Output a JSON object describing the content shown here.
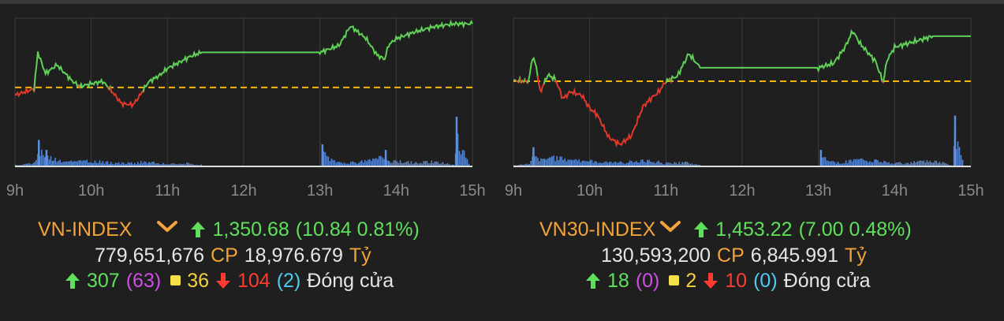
{
  "colors": {
    "background": "#1f1f1f",
    "grid": "#3c3c3c",
    "axis": "#dddddd",
    "up_line": "#5fd157",
    "down_line": "#e0392b",
    "reference": "#f5b800",
    "volume": "#5b8fe0",
    "label_orange": "#f2a33a",
    "up_green": "#5fe05a",
    "down_red": "#ff3b30"
  },
  "icons": {
    "up": "arrow-up-icon",
    "down": "arrow-down-icon",
    "chevron": "chevron-down-icon",
    "unchanged": "yellow-square-icon"
  },
  "chart_data": [
    {
      "type": "line",
      "x_ticks": [
        "9h",
        "10h",
        "11h",
        "12h",
        "13h",
        "14h",
        "15h"
      ],
      "x_range": [
        9,
        15
      ],
      "reference": 1339.84,
      "y_range": [
        1326,
        1352
      ],
      "price_series": {
        "x": [
          9.0,
          9.25,
          9.3,
          9.4,
          9.55,
          9.75,
          9.85,
          10.0,
          10.15,
          10.25,
          10.4,
          10.55,
          10.65,
          10.75,
          10.9,
          11.0,
          11.15,
          11.3,
          11.45,
          12.0,
          13.0,
          13.25,
          13.4,
          13.6,
          13.75,
          13.85,
          13.9,
          14.0,
          14.25,
          14.5,
          14.75,
          15.0
        ],
        "y": [
          1338.5,
          1339.6,
          1346.0,
          1342.3,
          1343.8,
          1341.0,
          1340.0,
          1340.5,
          1340.9,
          1339.5,
          1337.0,
          1336.8,
          1338.7,
          1340.8,
          1342.0,
          1343.2,
          1344.2,
          1345.3,
          1346.0,
          1346.0,
          1346.0,
          1347.2,
          1350.6,
          1348.5,
          1345.5,
          1344.8,
          1347.3,
          1348.4,
          1349.6,
          1350.5,
          1351.0,
          1351.0
        ]
      },
      "volume_series": {
        "x": [
          9.0,
          9.1,
          9.15,
          9.25,
          9.3,
          9.4,
          9.5,
          9.75,
          10.0,
          10.25,
          10.5,
          10.75,
          11.0,
          11.25,
          11.45,
          13.0,
          13.02,
          13.25,
          13.5,
          13.85,
          13.9,
          14.25,
          14.5,
          14.75,
          14.78,
          14.95
        ],
        "v": [
          4,
          6,
          8,
          11,
          48,
          30,
          22,
          15,
          17,
          12,
          10,
          16,
          8,
          9,
          6,
          0,
          40,
          11,
          13,
          30,
          18,
          12,
          16,
          4,
          90,
          6
        ]
      },
      "volume_max": 100
    },
    {
      "type": "line",
      "x_ticks": [
        "9h",
        "10h",
        "11h",
        "12h",
        "13h",
        "14h",
        "15h"
      ],
      "x_range": [
        9,
        15
      ],
      "reference": 1446.22,
      "y_range": [
        1433,
        1456
      ],
      "price_series": {
        "x": [
          9.0,
          9.2,
          9.25,
          9.3,
          9.35,
          9.45,
          9.55,
          9.65,
          9.75,
          9.9,
          10.0,
          10.1,
          10.25,
          10.4,
          10.55,
          10.7,
          10.8,
          10.9,
          11.0,
          11.15,
          11.3,
          11.45,
          12.0,
          12.5,
          13.0,
          13.2,
          13.35,
          13.45,
          13.55,
          13.75,
          13.85,
          13.9,
          14.0,
          14.3,
          14.5,
          15.0
        ],
        "y": [
          1446.3,
          1446.2,
          1450.0,
          1448.5,
          1444.5,
          1447.2,
          1446.5,
          1443.5,
          1444.6,
          1444.0,
          1442.0,
          1441.0,
          1437.5,
          1436.4,
          1437.8,
          1442.3,
          1443.5,
          1444.5,
          1446.2,
          1447.0,
          1450.5,
          1448.3,
          1448.3,
          1448.3,
          1448.3,
          1449.0,
          1451.5,
          1454.0,
          1452.0,
          1449.3,
          1446.0,
          1449.5,
          1451.5,
          1452.5,
          1453.2,
          1453.2
        ]
      },
      "volume_series": {
        "x": [
          9.0,
          9.2,
          9.25,
          9.4,
          9.5,
          9.75,
          10.0,
          10.25,
          10.5,
          10.75,
          11.0,
          11.25,
          11.45,
          13.0,
          13.02,
          13.25,
          13.5,
          13.75,
          14.0,
          14.25,
          14.5,
          14.75,
          14.78,
          14.9
        ],
        "v": [
          3,
          8,
          35,
          22,
          28,
          20,
          16,
          12,
          14,
          20,
          10,
          12,
          6,
          0,
          30,
          12,
          20,
          18,
          10,
          14,
          18,
          4,
          92,
          8
        ]
      },
      "volume_max": 100
    }
  ],
  "panels": [
    {
      "index_name": "VN-INDEX",
      "value": "1,350.68",
      "change": "(10.84 0.81%)",
      "volume": "779,651,676",
      "volume_unit": "CP",
      "turnover": "18,976.679",
      "turnover_unit": "Tỷ",
      "advancers": "307",
      "ceiling": "(63)",
      "unchanged": "36",
      "decliners": "104",
      "floor": "(2)",
      "status": "Đóng cửa"
    },
    {
      "index_name": "VN30-INDEX",
      "value": "1,453.22",
      "change": "(7.00 0.48%)",
      "volume": "130,593,200",
      "volume_unit": "CP",
      "turnover": "6,845.991",
      "turnover_unit": "Tỷ",
      "advancers": "18",
      "ceiling": "(0)",
      "unchanged": "2",
      "decliners": "10",
      "floor": "(0)",
      "status": "Đóng cửa"
    }
  ]
}
